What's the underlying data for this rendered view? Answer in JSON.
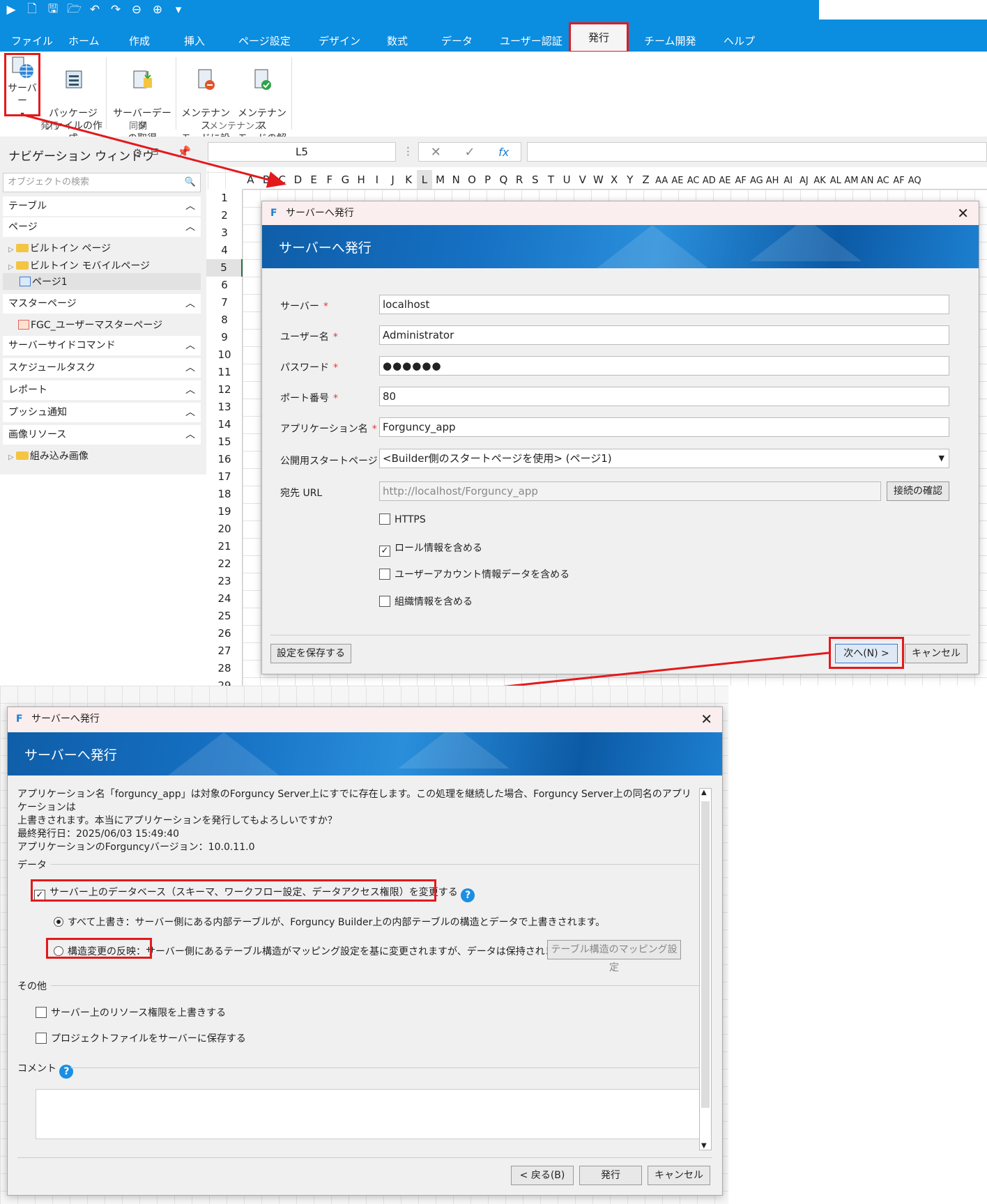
{
  "colors": {
    "accent": "#0b8de0",
    "highlight": "#e3191c"
  },
  "ribbon_tabs": [
    "ファイル",
    "ホーム",
    "作成",
    "挿入",
    "ページ設定",
    "デザイン",
    "数式",
    "データ",
    "ユーザー認証",
    "発行",
    "チーム開発",
    "ヘルプ"
  ],
  "ribbon": {
    "server": "サーバー",
    "package": "パッケージ\nファイルの作成",
    "getdata": "サーバーデータ\nの取得",
    "maint_on": "メンテナンス\nモードに設定",
    "maint_off": "メンテナンス\nモードの解除",
    "group_publish": "発行",
    "group_sync": "同期",
    "group_maint": "メンテナンス"
  },
  "nav": {
    "title": "ナビゲーション ウィンドウ",
    "search_placeholder": "オブジェクトの検索",
    "sections": [
      "テーブル",
      "ページ",
      "マスターページ",
      "サーバーサイドコマンド",
      "スケジュールタスク",
      "レポート",
      "プッシュ通知",
      "画像リソース"
    ],
    "builtin_page": "ビルトイン ページ",
    "builtin_mobile": "ビルトイン モバイルページ",
    "page1": "ページ1",
    "master_page": "FGC_ユーザーマスターページ",
    "builtin_images": "組み込み画像"
  },
  "formula": {
    "cellref": "L5"
  },
  "sheet": {
    "columns": [
      "A",
      "B",
      "C",
      "D",
      "E",
      "F",
      "G",
      "H",
      "I",
      "J",
      "K",
      "L",
      "M",
      "N",
      "O",
      "P",
      "Q",
      "R",
      "S",
      "T",
      "U",
      "V",
      "W",
      "X",
      "Y",
      "Z",
      "AA",
      "AE",
      "AC",
      "AD",
      "AE",
      "AF",
      "AG",
      "AH",
      "AI",
      "AJ",
      "AK",
      "AL",
      "AM",
      "AN",
      "AC",
      "AF",
      "AQ"
    ],
    "rows": [
      "1",
      "2",
      "3",
      "4",
      "5",
      "6",
      "7",
      "8",
      "9",
      "10",
      "11",
      "12",
      "13",
      "14",
      "15",
      "16",
      "17",
      "18",
      "19",
      "20",
      "21",
      "22",
      "23",
      "24",
      "25",
      "26",
      "27",
      "28",
      "29"
    ]
  },
  "dialog1": {
    "title": "サーバーへ発行",
    "banner": "サーバーへ発行",
    "server_label": "サーバー",
    "server": "localhost",
    "user_label": "ユーザー名",
    "user": "Administrator",
    "password_label": "パスワード",
    "password": "●●●●●●",
    "port_label": "ポート番号",
    "port": "80",
    "app_label": "アプリケーション名",
    "app": "Forguncy_app",
    "start_label": "公開用スタートページ",
    "start": "<Builder側のスタートページを使用> (ページ1)",
    "url_label": "宛先 URL",
    "url": "http://localhost/Forguncy_app",
    "check_conn": "接続の確認",
    "https": "HTTPS",
    "roles": "ロール情報を含める",
    "accounts": "ユーザーアカウント情報データを含める",
    "org": "組織情報を含める",
    "save": "設定を保存する",
    "next": "次へ(N) >",
    "cancel": "キャンセル"
  },
  "dialog2": {
    "title": "サーバーへ発行",
    "banner": "サーバーへ発行",
    "msg1": "アプリケーション名「forguncy_app」は対象のForguncy Server上にすでに存在します。この処理を継続した場合、Forguncy Server上の同名のアプリケーションは",
    "msg2": "上書きされます。本当にアプリケーションを発行してもよろしいですか？",
    "msg3": "最終発行日：2025/06/03 15:49:40",
    "msg4": "アプリケーションのForguncyバージョン：10.0.11.0",
    "data_group": "データ",
    "change_db": "サーバー上のデータベース（スキーマ、ワークフロー設定、データアクセス権限）を変更する",
    "overwrite_all": "すべて上書き：サーバー側にある内部テーブルが、Forguncy Builder上の内部テーブルの構造とデータで上書きされます。",
    "reflect": "構造変更の反映：",
    "reflect_desc": "サーバー側にあるテーブル構造がマッピング設定を基に変更されますが、データは保持されます。",
    "mapping": "テーブル構造のマッピング設定",
    "other_group": "その他",
    "overwrite_perm": "サーバー上のリソース権限を上書きする",
    "save_project": "プロジェクトファイルをサーバーに保存する",
    "comment": "コメント",
    "back": "< 戻る(B)",
    "publish": "発行",
    "cancel": "キャンセル"
  },
  "icons": [
    "play-icon",
    "new-icon",
    "save-icon",
    "open-icon",
    "undo-icon",
    "redo-icon",
    "back-icon",
    "forward-icon",
    "dropdown-icon",
    "gear-icon",
    "pin-icon",
    "close-icon",
    "help-icon"
  ]
}
